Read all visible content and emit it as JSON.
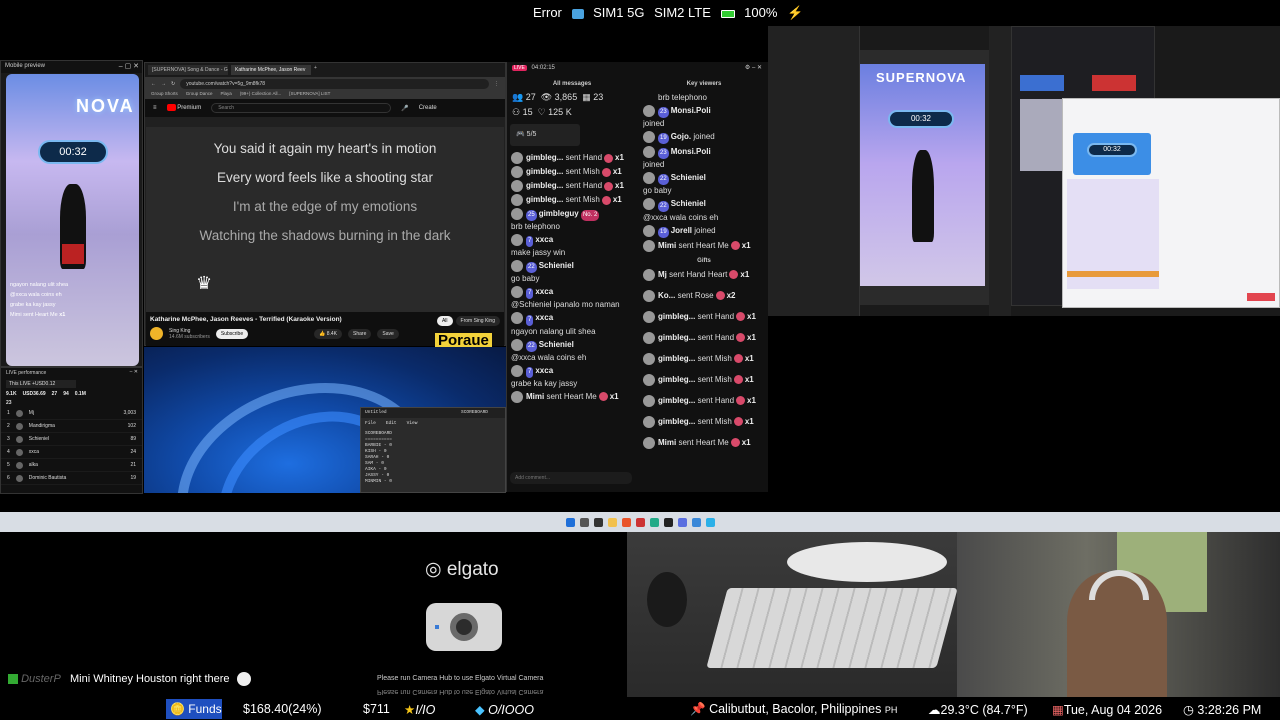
{
  "status_bar": {
    "error": "Error",
    "sim1": "SIM1 5G",
    "sim2": "SIM2 LTE",
    "battery": "100%"
  },
  "mobile_preview": {
    "title": "Mobile preview",
    "timer": "00:32",
    "logo_text": "NOVA",
    "comments": [
      "ngayon nalang ulit shea",
      "@xxca wala coins eh",
      "grabe ka kay jassy"
    ],
    "gift_line": "Mimi sent Heart Me",
    "gift_count": "x1"
  },
  "live_performance": {
    "title": "LIVE performance",
    "this_live": "This LIVE +USD0.12",
    "stats": [
      "9.1K",
      "USD36.69",
      "27",
      "94",
      "0.1M"
    ],
    "total": "23",
    "rows": [
      {
        "rank": "1",
        "name": "Mj",
        "value": "3,003"
      },
      {
        "rank": "2",
        "name": "Mandirigma",
        "value": "102"
      },
      {
        "rank": "3",
        "name": "Schieniel",
        "value": "89"
      },
      {
        "rank": "4",
        "name": "xxca",
        "value": "24"
      },
      {
        "rank": "5",
        "name": "alka",
        "value": "21"
      },
      {
        "rank": "6",
        "name": "Dominic Bautista",
        "value": "19"
      }
    ]
  },
  "browser": {
    "tabs": [
      "[SUPERNOVA] Song & Dance - Goo",
      "Katharine McPhee, Jason Reev"
    ],
    "url": "youtube.com/watch?v=5g_9m8fk78",
    "bookmarks": [
      "Group Shorts",
      "Group Dance",
      "Playa",
      "(99+) Collection All...",
      "[SUPERNOVA] LIST"
    ],
    "yt_brand": "Premium",
    "search_placeholder": "Search",
    "create": "Create",
    "lyrics": [
      "You said it again my heart's in motion",
      "Every word feels like a shooting star",
      "I'm at the edge of my emotions",
      "Watching the shadows burning in the dark"
    ],
    "video_title": "Katharine McPhee, Jason Reeves - Terrified (Karaoke Version)",
    "channel": "Sing King",
    "subscribers": "14.6M subscribers",
    "subscribe": "Subscribe",
    "likes": "8.4K",
    "share": "Share",
    "save": "Save",
    "filter_all": "All",
    "filter_from": "From Sing King",
    "overlay_word": "Poraue"
  },
  "notepad": {
    "title": "Untitled",
    "scoreboard_tab": "SCOREBOARD",
    "menu": [
      "File",
      "Edit",
      "View"
    ],
    "lines": [
      "SCOREBOARD",
      "==========",
      "BARBIE - 0",
      "KISH - 0",
      "SARAH - 0",
      "SAM - 0",
      "AIKA - 0",
      "JASSY - 0",
      "MINMIN - 0"
    ]
  },
  "chat": {
    "time": "04:02:15",
    "all_messages": "All messages",
    "key_viewers": "Key viewers",
    "gifts": "Gifts",
    "stats": {
      "viewers": "27",
      "views": "3,865",
      "gifts": "23",
      "likes_a": "15",
      "likes": "125 K"
    },
    "rounds": "5/5",
    "messages_left": [
      {
        "user": "gimbleg...",
        "text": "sent Hand",
        "count": "x1"
      },
      {
        "user": "gimbleg...",
        "text": "sent Mish",
        "count": "x1"
      },
      {
        "user": "gimbleg...",
        "text": "sent Hand",
        "count": "x1"
      },
      {
        "user": "gimbleg...",
        "text": "sent Mish",
        "count": "x1"
      },
      {
        "user": "gimbleguy",
        "level": "25",
        "badge": "No. 2",
        "text": "brb telephono"
      },
      {
        "user": "xxca",
        "level": "7",
        "text": "make jassy win"
      },
      {
        "user": "Schieniel",
        "level": "22",
        "text": "go baby"
      },
      {
        "user": "xxca",
        "level": "7",
        "text": "@Schieniel ipanalo mo naman"
      },
      {
        "user": "xxca",
        "level": "7",
        "text": "ngayon nalang ulit shea"
      },
      {
        "user": "Schieniel",
        "level": "22",
        "text": "@xxca wala coins eh"
      },
      {
        "user": "xxca",
        "level": "7",
        "text": "grabe ka kay jassy"
      },
      {
        "user": "Mimi",
        "text": "sent Heart Me",
        "count": "x1"
      }
    ],
    "input_placeholder": "Add comment...",
    "key_left": [
      {
        "text": "brb telephono"
      },
      {
        "user": "Monsi.Poli",
        "level": "23",
        "text": "joined"
      },
      {
        "user": "Gojo.",
        "level": "19",
        "text": "joined"
      },
      {
        "user": "Monsi.Poli",
        "level": "23",
        "text": "joined"
      },
      {
        "user": "Schieniel",
        "level": "22",
        "text": "go baby"
      },
      {
        "user": "Schieniel",
        "level": "22",
        "text": "@xxca wala coins eh"
      },
      {
        "user": "Jorell",
        "level": "19",
        "text": "joined"
      },
      {
        "user": "Mimi",
        "text": "sent Heart Me",
        "count": "x1"
      }
    ],
    "gifts_list": [
      {
        "user": "Mj",
        "text": "sent Hand Heart",
        "count": "x1"
      },
      {
        "user": "Ko...",
        "text": "sent Rose",
        "count": "x2"
      },
      {
        "user": "gimbleg...",
        "text": "sent Hand",
        "count": "x1"
      },
      {
        "user": "gimbleg...",
        "text": "sent Hand",
        "count": "x1"
      },
      {
        "user": "gimbleg...",
        "text": "sent Mish",
        "count": "x1"
      },
      {
        "user": "gimbleg...",
        "text": "sent Mish",
        "count": "x1"
      },
      {
        "user": "gimbleg...",
        "text": "sent Hand",
        "count": "x1"
      },
      {
        "user": "gimbleg...",
        "text": "sent Mish",
        "count": "x1"
      },
      {
        "user": "Mimi",
        "text": "sent Heart Me",
        "count": "x1"
      }
    ]
  },
  "studio": {
    "timer": "00:32",
    "logo_text": "SUPERNOVA"
  },
  "elgato": {
    "logo": "elgato",
    "message": "Please run Camera Hub to use Elgato Virtual Camera"
  },
  "ticker": {
    "user": "DusterP",
    "message": "Mini Whitney Houston right there"
  },
  "bottom_bar": {
    "funds_label": "Funds",
    "funds_value": "$168.40(24%)",
    "goal": "$711",
    "star": "I/IO",
    "diamond": "O/IOOO",
    "location": "Calibutbut, Bacolor, Philippines",
    "country": "PH",
    "weather": "29.3°C (84.7°F)",
    "date": "Tue, Aug 04 2026",
    "time": "3:28:26 PM"
  }
}
